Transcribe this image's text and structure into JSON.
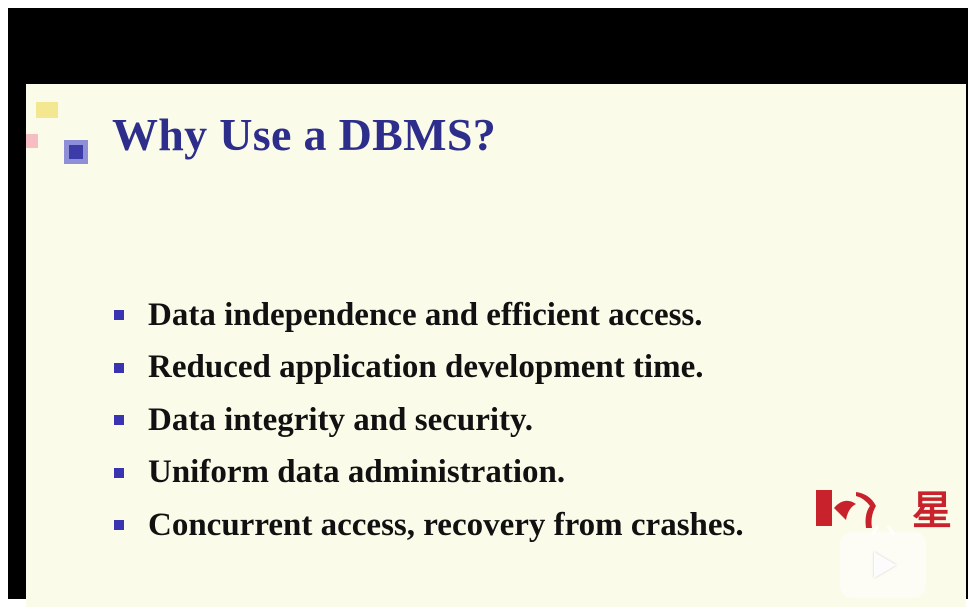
{
  "slide": {
    "title": "Why Use a DBMS?",
    "bullets": [
      "Data independence and efficient access.",
      "Reduced application development time.",
      "Data integrity and security.",
      "Uniform data administration.",
      "Concurrent access, recovery from crashes."
    ]
  },
  "colors": {
    "slide_background": "#fbfbe9",
    "title": "#2d2d8c",
    "bullet_marker": "#3a34b0",
    "bullet_text": "#111111",
    "letterbox": "#000000",
    "logo": "#c8232c"
  },
  "icons": {
    "logo": "red-brand-logo-icon",
    "play": "play-icon"
  }
}
